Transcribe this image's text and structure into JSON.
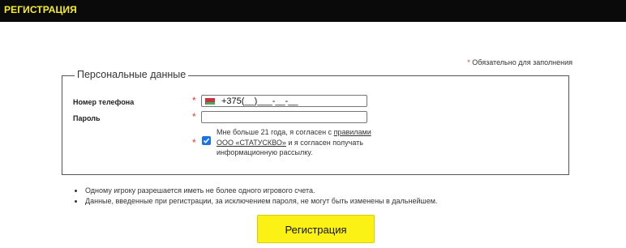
{
  "header": {
    "title": "РЕГИСТРАЦИЯ"
  },
  "form": {
    "required_star": "*",
    "required_note": "Обязательно для заполнения",
    "section_title": "Персональные данные",
    "phone": {
      "label": "Номер телефона",
      "value": "+375(__)___-__-__"
    },
    "password": {
      "label": "Пароль",
      "value": ""
    },
    "consent": {
      "checked": true,
      "text_before": "Мне больше 21 года, я согласен с ",
      "link_text": "правилами ООО «СТАТУСКВО»",
      "text_after": " и я согласен получать информационную рассылку."
    }
  },
  "notes": [
    "Одному игроку разрешается иметь не более одного игрового счета.",
    "Данные, введенные при регистрации, за исключением пароля, не могут быть изменены в дальнейшем."
  ],
  "submit_label": "Регистрация",
  "colors": {
    "topbar": "#0a0a0a",
    "brand_yellow": "#fbf115",
    "star_red": "#e53935",
    "checkbox_blue": "#1a73e8"
  }
}
